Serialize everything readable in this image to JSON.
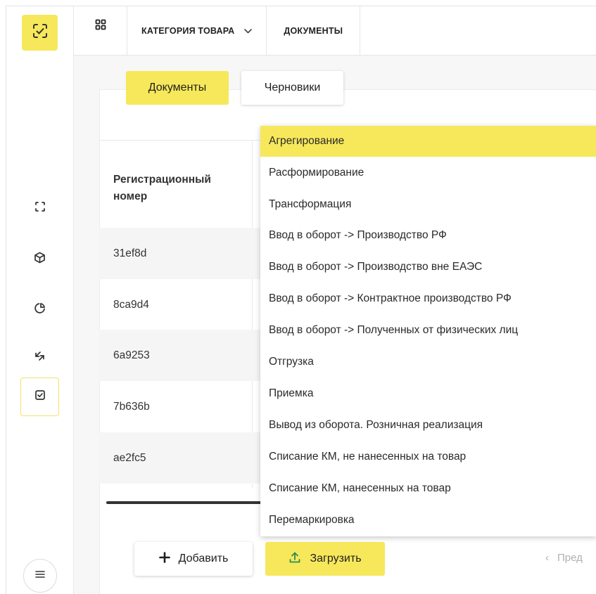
{
  "header": {
    "category_label": "КАТЕГОРИЯ ТОВАРА",
    "documents_label": "ДОКУМЕНТЫ"
  },
  "tabs": [
    {
      "label": "Документы",
      "active": true
    },
    {
      "label": "Черновики",
      "active": false
    }
  ],
  "table": {
    "columns": [
      "Регистрационный номер"
    ],
    "rows": [
      "31ef8d",
      "8ca9d4",
      "6a9253",
      "7b636b",
      "ae2fc5"
    ]
  },
  "dropdown": {
    "highlighted_index": 0,
    "items": [
      "Агрегирование",
      "Расформирование",
      "Трансформация",
      "Ввод в оборот -> Производство РФ",
      "Ввод в оборот -> Производство вне ЕАЭС",
      "Ввод в оборот -> Контрактное производство РФ",
      "Ввод в оборот -> Полученных от физических лиц",
      "Отгрузка",
      "Приемка",
      "Вывод из оборота. Розничная реализация",
      "Списание КМ, не нанесенных на товар",
      "Списание КМ, нанесенных на товар",
      "Перемаркировка"
    ]
  },
  "actions": {
    "add_label": "Добавить",
    "upload_label": "Загрузить",
    "prev_label": "Пред"
  },
  "colors": {
    "accent": "#f6e85a",
    "border": "#e6e6e6",
    "text": "#1f1f1f"
  },
  "icons": {
    "logo": "scan-check-icon",
    "nav": [
      "scan-frame-icon",
      "box-icon",
      "pie-chart-icon",
      "arrows-exchange-icon",
      "checkbox-icon"
    ],
    "menu": "hamburger-icon",
    "grid": "apps-grid-icon",
    "add": "plus-icon",
    "upload": "upload-icon",
    "prev": "chevron-left-icon"
  }
}
